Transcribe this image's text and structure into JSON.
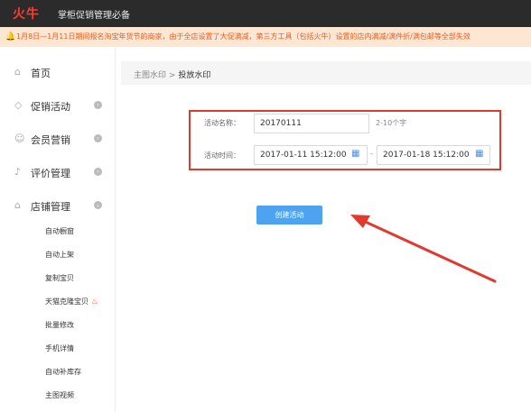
{
  "header": {
    "logo": "火牛",
    "title": "掌柜促销管理必备"
  },
  "notice": {
    "icon": "bell-icon",
    "text": "1月8日—1月11日期间报名淘宝年货节的商家，由于全店设置了大促满减，第三方工具（包括火牛）设置的店内满减/满件折/满包邮等全部失效"
  },
  "sidebar": {
    "items": [
      {
        "label": "首页",
        "icon": "home-icon"
      },
      {
        "label": "促销活动",
        "icon": "tag-icon"
      },
      {
        "label": "会员营销",
        "icon": "user-icon"
      },
      {
        "label": "评价管理",
        "icon": "bell-icon"
      },
      {
        "label": "店铺管理",
        "icon": "store-icon"
      }
    ],
    "sub_items": [
      "自动橱窗",
      "自动上架",
      "复制宝贝",
      "天猫克隆宝贝",
      "批量修改",
      "手机详情",
      "自动补库存",
      "主图视频"
    ]
  },
  "breadcrumb": {
    "parent": "主图水印",
    "separator": ">",
    "current": "投放水印"
  },
  "form": {
    "name_label": "活动名称：",
    "name_value": "20170111",
    "name_hint": "2-10个字",
    "time_label": "活动时间：",
    "start_time": "2017-01-11 15:12:00",
    "dash": "-",
    "end_time": "2017-01-18 15:12:00",
    "submit_label": "创建活动"
  },
  "colors": {
    "accent": "#4da3f0",
    "annotation": "#e03a2f",
    "notice_text": "#f25b1b",
    "logo": "#ff3b2f"
  }
}
